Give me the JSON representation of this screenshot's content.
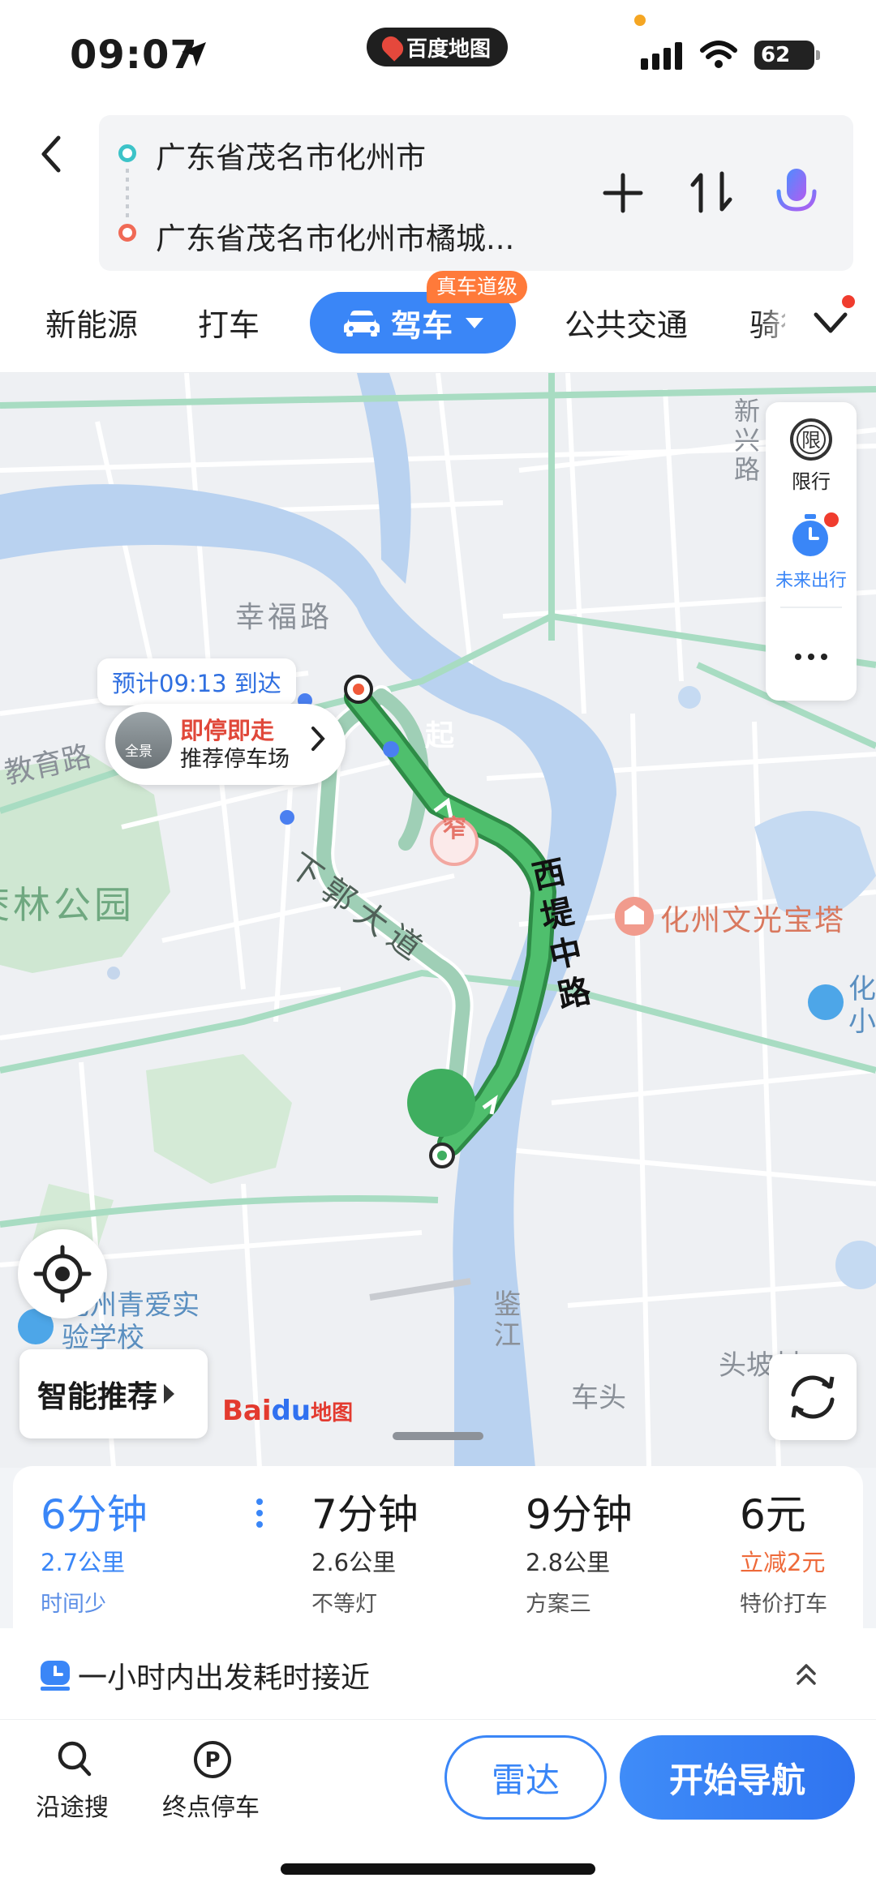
{
  "status_bar": {
    "time": "09:07",
    "app_name": "百度地图",
    "battery": "62"
  },
  "route": {
    "from": "广东省茂名市化州市",
    "to": "广东省茂名市化州市橘城..."
  },
  "modes": {
    "tabs": [
      "新能源",
      "打车",
      "驾车",
      "公共交通",
      "骑行"
    ],
    "selected": "驾车",
    "badge": "真车道级"
  },
  "map": {
    "eta": "预计09:13 到达",
    "parking_title": "即停即走",
    "parking_sub": "推荐停车场",
    "parking_thumb_label": "全景",
    "narrow_marker": "窄",
    "start_marker": "起",
    "labels": {
      "road_xingfu": "幸福路",
      "road_jiaoyu": "教育路",
      "park": "茭林公园",
      "road_xiaguo": "下郭大道",
      "road_xidi": "西堤中路",
      "pagoda": "化州文光宝塔",
      "road_xinxing": "新兴路",
      "school": "化州青爱实验学校",
      "river": "鉴江",
      "chetou": "车头",
      "toupo": "头坡村",
      "edge_hua": "化",
      "edge_xiao": "小"
    },
    "side_panel": {
      "restrict_icon_text": "限",
      "restrict_label": "限行",
      "future_label": "未来出行"
    },
    "smart_recommend": "智能推荐",
    "logo_bai": "Bai",
    "logo_du": "du",
    "logo_map": "地图",
    "colors": {
      "route_primary": "#3fae5f",
      "route_alt": "#9fcfb6",
      "river": "#b9d2f0",
      "accent": "#3a86f7"
    }
  },
  "routes": [
    {
      "time": "6分钟",
      "distance": "2.7公里",
      "tag": "时间少",
      "selected": true
    },
    {
      "time": "7分钟",
      "distance": "2.6公里",
      "tag": "不等灯",
      "selected": false
    },
    {
      "time": "9分钟",
      "distance": "2.8公里",
      "tag": "方案三",
      "selected": false
    },
    {
      "time": "6元",
      "distance": "立减2元",
      "tag": "特价打车",
      "selected": false
    }
  ],
  "tip": "一小时内出发耗时接近",
  "bottom": {
    "search_label": "沿途搜",
    "park_label": "终点停车",
    "park_icon_text": "P",
    "radar_label": "雷达",
    "navigate_label": "开始导航"
  }
}
